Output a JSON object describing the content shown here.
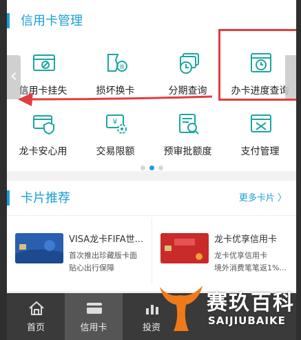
{
  "credit_card_management": {
    "title": "信用卡管理",
    "tiles": [
      {
        "label": "信用卡挂失",
        "icon": "card-edit-icon"
      },
      {
        "label": "损坏换卡",
        "icon": "card-replace-icon"
      },
      {
        "label": "分期查询",
        "icon": "installment-clock-icon"
      },
      {
        "label": "办卡进度查询",
        "icon": "progress-clock-icon"
      },
      {
        "label": "龙卡安心用",
        "icon": "shield-card-icon"
      },
      {
        "label": "交易限额",
        "icon": "limit-gear-icon"
      },
      {
        "label": "预审批额度",
        "icon": "search-doc-icon"
      },
      {
        "label": "支付管理",
        "icon": "tools-icon"
      }
    ],
    "pager": {
      "count": 3,
      "active_index": 1
    }
  },
  "card_recommend": {
    "title": "卡片推荐",
    "more_label": "更多卡片 〉",
    "cards": [
      {
        "name": "VISA龙卡FIFA世...",
        "desc1": "首次推出珍藏版卡面",
        "desc2": "贴心出行保障",
        "card_color": "#2a5fb0"
      },
      {
        "name": "龙卡优享信用卡",
        "desc1": "龙卡优享信用卡",
        "desc2": "境外消费笔笔返1%...",
        "card_color": "#c92a2a"
      }
    ]
  },
  "tabbar": {
    "items": [
      {
        "label": "首页",
        "icon": "home-icon",
        "active": false
      },
      {
        "label": "信用卡",
        "icon": "credit-card-icon",
        "active": true
      },
      {
        "label": "投资",
        "icon": "investment-chart-icon",
        "active": false
      }
    ]
  },
  "watermark": {
    "text_cn": "赛玖百科",
    "text_en": "SAIJIUBAIKE"
  },
  "colors": {
    "accent": "#1a9ed8",
    "annotation": "#e23c3c"
  }
}
